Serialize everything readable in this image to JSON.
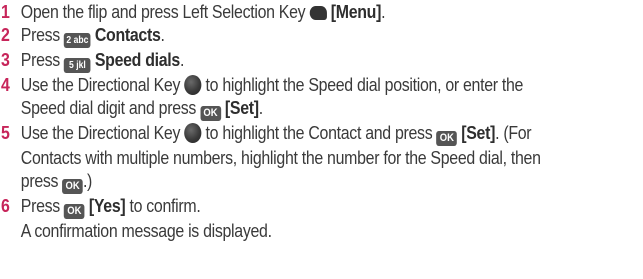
{
  "steps": [
    {
      "number": "1",
      "text1": "Open the flip and press Left Selection Key ",
      "icon": "left-selection-key-icon",
      "bold1": "[Menu]",
      "text2": "."
    },
    {
      "number": "2",
      "text1": "Press ",
      "key_label": "2 abc",
      "bold1": "Contacts",
      "text2": "."
    },
    {
      "number": "3",
      "text1": "Press ",
      "key_label": "5 jkl",
      "bold1": "Speed dials",
      "text2": "."
    },
    {
      "number": "4",
      "line1_text1": "Use the Directional Key ",
      "line1_text2": " to highlight the Speed dial position, or enter the",
      "line2_text1": "Speed dial digit and press ",
      "key_label": "OK",
      "bold1": "[Set]",
      "text_end": "."
    },
    {
      "number": "5",
      "line1_text1": "Use the Directional Key ",
      "line1_text2": " to highlight the Contact and press ",
      "key_label": "OK",
      "bold1": "[Set]",
      "line1_text3": ". (For",
      "line2": "Contacts with multiple numbers, highlight the number for the Speed dial, then",
      "line3_text1": "press ",
      "line3_text2": ".)"
    },
    {
      "number": "6",
      "text1": "Press ",
      "key_label": "OK",
      "bold1": "[Yes]",
      "text2": " to confirm.",
      "sub": "A confirmation message is displayed."
    }
  ],
  "colors": {
    "step_number": "#c7255a",
    "text": "#3a3a3a",
    "key_background": "#555555"
  }
}
